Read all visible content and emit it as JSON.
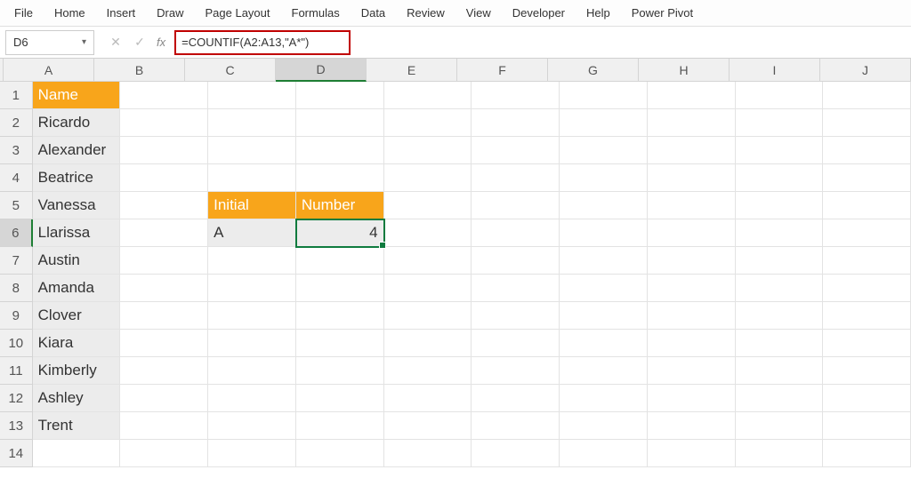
{
  "ribbon": {
    "items": [
      "File",
      "Home",
      "Insert",
      "Draw",
      "Page Layout",
      "Formulas",
      "Data",
      "Review",
      "View",
      "Developer",
      "Help",
      "Power Pivot"
    ]
  },
  "formula_bar": {
    "namebox": "D6",
    "cancel": "✕",
    "enter": "✓",
    "fx": "fx",
    "formula": "=COUNTIF(A2:A13,\"A*\")"
  },
  "columns": [
    "A",
    "B",
    "C",
    "D",
    "E",
    "F",
    "G",
    "H",
    "I",
    "J"
  ],
  "active_col": "D",
  "active_row": 6,
  "row_count": 14,
  "cells": {
    "A1": {
      "value": "Name",
      "class": "header-orange"
    },
    "A2": {
      "value": "Ricardo",
      "class": "altfill"
    },
    "A3": {
      "value": "Alexander",
      "class": "altfill"
    },
    "A4": {
      "value": "Beatrice",
      "class": "altfill"
    },
    "A5": {
      "value": "Vanessa",
      "class": "altfill"
    },
    "A6": {
      "value": "Llarissa",
      "class": "altfill"
    },
    "A7": {
      "value": "Austin",
      "class": "altfill"
    },
    "A8": {
      "value": "Amanda",
      "class": "altfill"
    },
    "A9": {
      "value": "Clover",
      "class": "altfill"
    },
    "A10": {
      "value": "Kiara",
      "class": "altfill"
    },
    "A11": {
      "value": "Kimberly",
      "class": "altfill"
    },
    "A12": {
      "value": "Ashley",
      "class": "altfill"
    },
    "A13": {
      "value": "Trent",
      "class": "altfill"
    },
    "C5": {
      "value": "Initial",
      "class": "header-orange"
    },
    "D5": {
      "value": "Number",
      "class": "header-orange"
    },
    "C6": {
      "value": "A",
      "class": "altfill"
    },
    "D6": {
      "value": "4",
      "class": "altfill right selected"
    }
  }
}
